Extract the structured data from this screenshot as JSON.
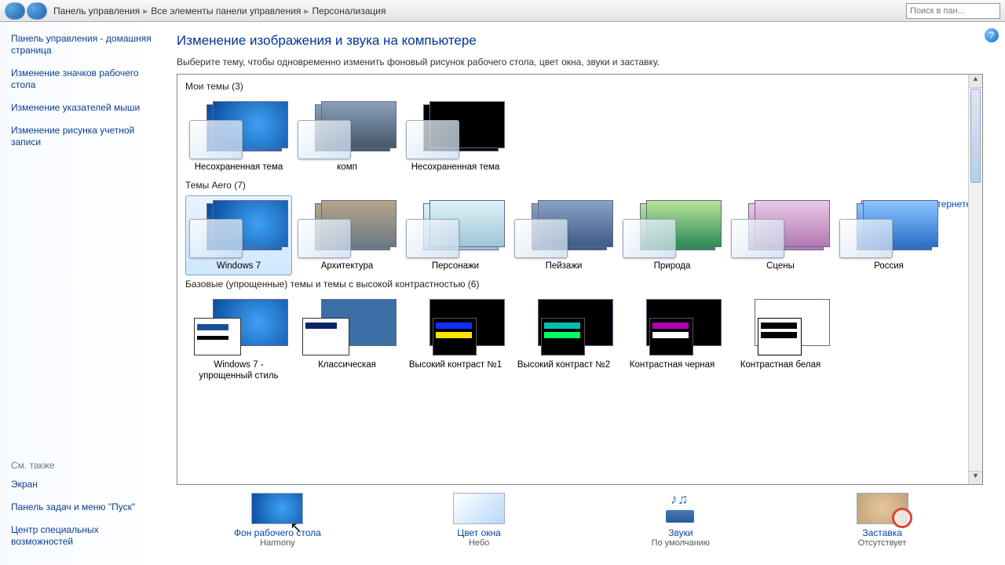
{
  "breadcrumb": {
    "p1": "Панель управления",
    "p2": "Все элементы панели управления",
    "p3": "Персонализация",
    "search_placeholder": "Поиск в пан..."
  },
  "sidebar": {
    "home": "Панель управления - домашняя страница",
    "icons": "Изменение значков рабочего стола",
    "pointers": "Изменение указателей мыши",
    "account_pic": "Изменение рисунка учетной записи",
    "see_also": "См. также",
    "screen": "Экран",
    "taskbar": "Панель задач и меню \"Пуск\"",
    "ease": "Центр специальных возможностей"
  },
  "main": {
    "title": "Изменение изображения и звука на компьютере",
    "subtitle": "Выберите тему, чтобы одновременно изменить фоновый рисунок рабочего стола, цвет окна, звуки и заставку.",
    "sec_my": "Мои темы (3)",
    "sec_aero": "Темы Aero (7)",
    "sec_basic": "Базовые (упрощенные) темы и темы с высокой контрастностью (6)",
    "more_online": "Другие темы в Интернете"
  },
  "themes_my": [
    {
      "label": "Несохраненная тема",
      "bg": "bg-blue"
    },
    {
      "label": "комп",
      "bg": "bg-city"
    },
    {
      "label": "Несохраненная тема",
      "bg": "bg-black"
    }
  ],
  "themes_aero": [
    {
      "label": "Windows 7",
      "bg": "bg-blue",
      "selected": true
    },
    {
      "label": "Архитектура",
      "bg": "bg-arch"
    },
    {
      "label": "Персонажи",
      "bg": "bg-char"
    },
    {
      "label": "Пейзажи",
      "bg": "bg-land"
    },
    {
      "label": "Природа",
      "bg": "bg-nature"
    },
    {
      "label": "Сцены",
      "bg": "bg-scenes"
    },
    {
      "label": "Россия",
      "bg": "bg-ru"
    }
  ],
  "themes_basic": [
    {
      "label": "Windows 7 - упрощенный стиль",
      "type": "basic",
      "bg": "bg-blue"
    },
    {
      "label": "Классическая",
      "type": "classic"
    },
    {
      "label": "Высокий контраст №1",
      "type": "hc",
      "back": "#000",
      "c1": "#1030ff",
      "c2": "#ffe400"
    },
    {
      "label": "Высокий контраст №2",
      "type": "hc",
      "back": "#000",
      "c1": "#00bfae",
      "c2": "#00ff66"
    },
    {
      "label": "Контрастная черная",
      "type": "hc",
      "back": "#000",
      "c1": "#b000b5",
      "c2": "#fff"
    },
    {
      "label": "Контрастная белая",
      "type": "hc",
      "back": "#fff",
      "c1": "#000",
      "c2": "#000",
      "box": "#fff"
    }
  ],
  "bottom": {
    "bg": {
      "title": "Фон рабочего стола",
      "value": "Harmony"
    },
    "color": {
      "title": "Цвет окна",
      "value": "Небо"
    },
    "sounds": {
      "title": "Звуки",
      "value": "По умолчанию"
    },
    "scr": {
      "title": "Заставка",
      "value": "Отсутствует"
    }
  }
}
